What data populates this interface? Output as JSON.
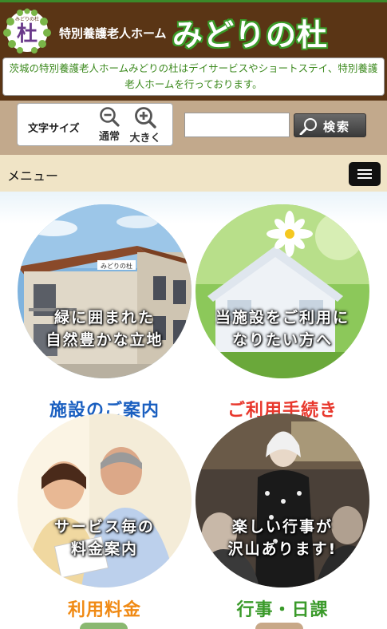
{
  "header": {
    "logo_text": "みどりの杜",
    "sub_title": "特別養護老人ホーム",
    "main_title": "みどりの杜"
  },
  "description": "茨城の特別養護老人ホームみどりの杜はデイサービスやショートステイ、特別養護老人ホームを行っております。",
  "toolbar": {
    "font_size_label": "文字サイズ",
    "normal_label": "通常",
    "large_label": "大きく",
    "search_placeholder": "",
    "search_value": "",
    "search_button_label": "検索"
  },
  "menu": {
    "label": "メニュー"
  },
  "tiles": [
    {
      "overlay": [
        "緑に囲まれた",
        "自然豊かな立地"
      ],
      "caption": "施設のご案内",
      "caption_color": "#1a5fc0",
      "sign_text": "みどりの杜"
    },
    {
      "overlay": [
        "当施設をご利用に",
        "なりたい方へ"
      ],
      "caption": "ご利用手続き",
      "caption_color": "#e8382d"
    },
    {
      "overlay": [
        "サービス毎の",
        "料金案内"
      ],
      "caption": "利用料金",
      "caption_color": "#f08a14"
    },
    {
      "overlay": [
        "楽しい行事が",
        "沢山あります!"
      ],
      "caption": "行事・日課",
      "caption_color": "#3a9a2a"
    }
  ],
  "colors": {
    "header_brown": "#5a3515",
    "accent_green": "#3a9a28",
    "toolbar_tan": "#c2a98c",
    "menubar_cream": "#f0e4c6"
  }
}
